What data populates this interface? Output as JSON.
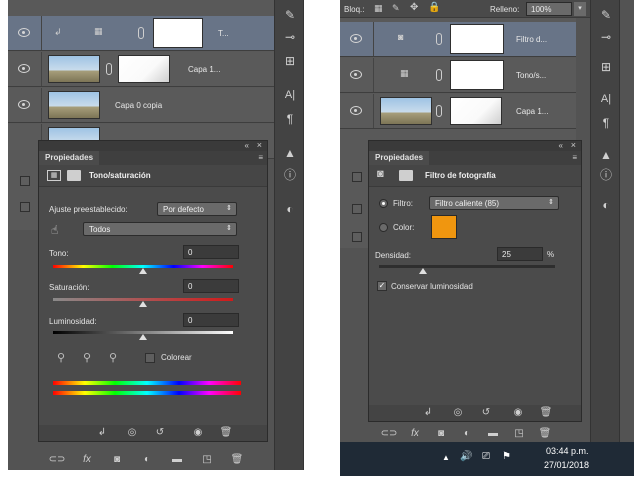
{
  "left": {
    "layers": [
      {
        "name": "T...",
        "selected": true
      },
      {
        "name": "Capa 1...",
        "selected": false
      },
      {
        "name": "Capa 0 copia",
        "selected": false
      }
    ],
    "panel": {
      "tab": "Propiedades",
      "title": "Tono/saturación",
      "preset_label": "Ajuste preestablecido:",
      "preset_value": "Por defecto",
      "channel_value": "Todos",
      "hue_label": "Tono:",
      "hue_value": "0",
      "sat_label": "Saturación:",
      "sat_value": "0",
      "light_label": "Luminosidad:",
      "light_value": "0",
      "colorize_label": "Colorear",
      "colorize_checked": false
    }
  },
  "right": {
    "top_bar": {
      "lock_label": "Bloq.:",
      "fill_label": "Relleno:",
      "fill_value": "100%"
    },
    "layers": [
      {
        "name": "Filtro d...",
        "selected": true
      },
      {
        "name": "Tono/s...",
        "selected": false
      },
      {
        "name": "Capa 1...",
        "selected": false
      }
    ],
    "panel": {
      "tab": "Propiedades",
      "title": "Filtro de fotografía",
      "filter_label": "Filtro:",
      "filter_value": "Filtro caliente (85)",
      "color_label": "Color:",
      "color_swatch": "#f0960f",
      "density_label": "Densidad:",
      "density_value": "25",
      "density_unit": "%",
      "preserve_label": "Conservar luminosidad",
      "preserve_checked": true
    },
    "taskbar": {
      "time": "03:44 p.m.",
      "date": "27/01/2018"
    }
  },
  "colors": {
    "panel_bg": "#4b4b4b",
    "selected_layer": "#687487",
    "accent_swatch": "#f0960f",
    "taskbar": "#1f2a36"
  }
}
